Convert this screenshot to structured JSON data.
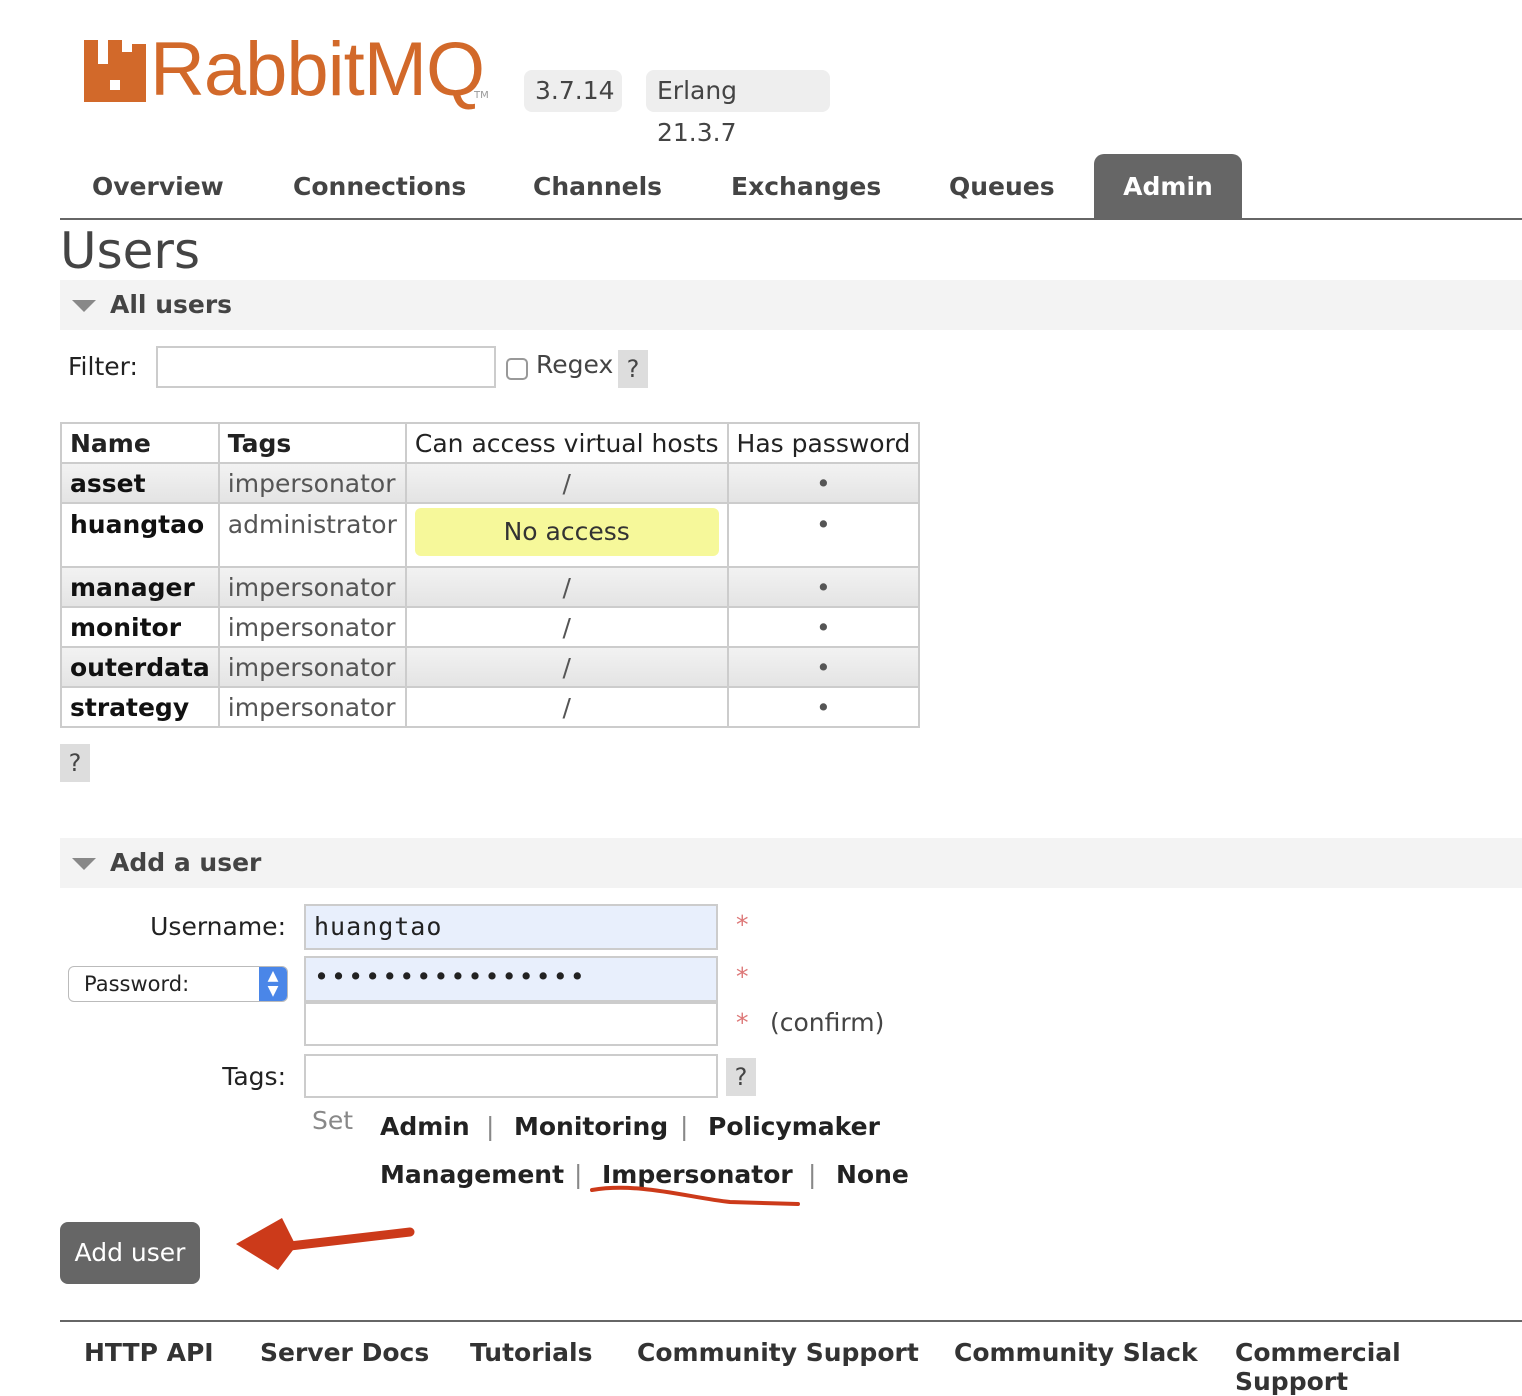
{
  "header": {
    "logo_text": "RabbitMQ",
    "logo_tm": "TM",
    "version": "3.7.14",
    "erlang": "Erlang 21.3.7",
    "brand_color": "#d2692a"
  },
  "tabs": [
    "Overview",
    "Connections",
    "Channels",
    "Exchanges",
    "Queues",
    "Admin"
  ],
  "active_tab": "Admin",
  "page_title": "Users",
  "all_users": {
    "heading": "All users",
    "filter_label": "Filter:",
    "filter_value": "",
    "regex_label": "Regex",
    "regex_checked": false,
    "help": "?",
    "columns": [
      "Name",
      "Tags",
      "Can access virtual hosts",
      "Has password"
    ],
    "rows": [
      {
        "name": "asset",
        "tags": "impersonator",
        "vhosts": "/",
        "has_password": "•"
      },
      {
        "name": "huangtao",
        "tags": "administrator",
        "vhosts": "No access",
        "has_password": "•"
      },
      {
        "name": "manager",
        "tags": "impersonator",
        "vhosts": "/",
        "has_password": "•"
      },
      {
        "name": "monitor",
        "tags": "impersonator",
        "vhosts": "/",
        "has_password": "•"
      },
      {
        "name": "outerdata",
        "tags": "impersonator",
        "vhosts": "/",
        "has_password": "•"
      },
      {
        "name": "strategy",
        "tags": "impersonator",
        "vhosts": "/",
        "has_password": "•"
      }
    ],
    "table_help": "?"
  },
  "add_user": {
    "heading": "Add a user",
    "username_label": "Username:",
    "username_value": "huangtao",
    "password_select": "Password:",
    "password_value": "••••••••••••••••",
    "confirm_value": "",
    "confirm_label": "(confirm)",
    "required": "*",
    "tags_label": "Tags:",
    "tags_value": "",
    "tags_help": "?",
    "set_label": "Set",
    "tag_links": [
      "Admin",
      "Monitoring",
      "Policymaker",
      "Management",
      "Impersonator",
      "None"
    ],
    "separator": "|",
    "submit": "Add user",
    "annotation_color": "#cc3a1a"
  },
  "footer": [
    "HTTP API",
    "Server Docs",
    "Tutorials",
    "Community Support",
    "Community Slack",
    "Commercial Support"
  ]
}
